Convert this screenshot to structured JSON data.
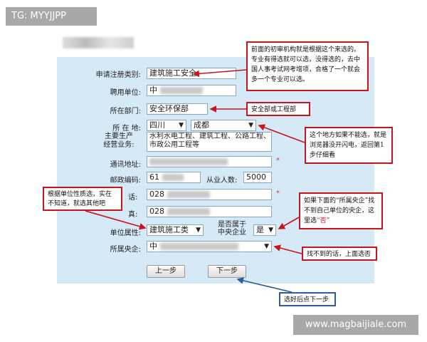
{
  "tag": "TG: MYYJJPP",
  "watermark": "www.magbaijiale.com",
  "form": {
    "category_label": "申请注册类别:",
    "category_value": "建筑施工安全",
    "employer_label": "聘用单位:",
    "employer_value": "中",
    "department_label": "所在部门:",
    "department_value": "安全环保部",
    "location_label": "所 在 地:",
    "province_value": "四川",
    "city_value": "成都",
    "business_label_1": "主要生产",
    "business_label_2": "经营业务:",
    "business_value": "水利水电工程、建筑工程、公路工程、市政公用工程等",
    "address_label": "通讯地址:",
    "postcode_label": "邮政编码:",
    "postcode_value": "61",
    "staff_label": "从业人数:",
    "staff_value": "5000",
    "phone_label_tail": "话:",
    "phone_value": "028",
    "fax_label_tail": "真:",
    "fax_value": "028",
    "nature_label": "单位属性:",
    "nature_value": "建筑施工类",
    "central_label_1": "是否属于",
    "central_label_2": "中央企业",
    "central_value": "是",
    "central_enterprise_label": "所属央企:",
    "central_enterprise_value": "中",
    "required_mark": "*"
  },
  "buttons": {
    "prev": "上一步",
    "next": "下一步"
  },
  "callouts": {
    "top": "前面的初审机构就是根据这个来选的。专业有得选就可以选，没得选的，去中国人事考试网考增项，合格了一个就会多一个专业可以选。",
    "department": "安全部或工程部",
    "location": "这个地方如果不能选，就是浏览器没开闪电，返回第1步仔细看",
    "nature": "根据单位性质选，实在不知道，就选其他吧",
    "central_part1": "如果下面的“所属央企”找不到自己单位的央企，这里选",
    "central_highlight": "“否”",
    "not_found": "找不到的话，上面选否",
    "next_tip": "选好后点下一步"
  },
  "colors": {
    "panel": "#d6e9f7",
    "callout_red": "#c4161c",
    "callout_blue": "#2f5e9e"
  }
}
